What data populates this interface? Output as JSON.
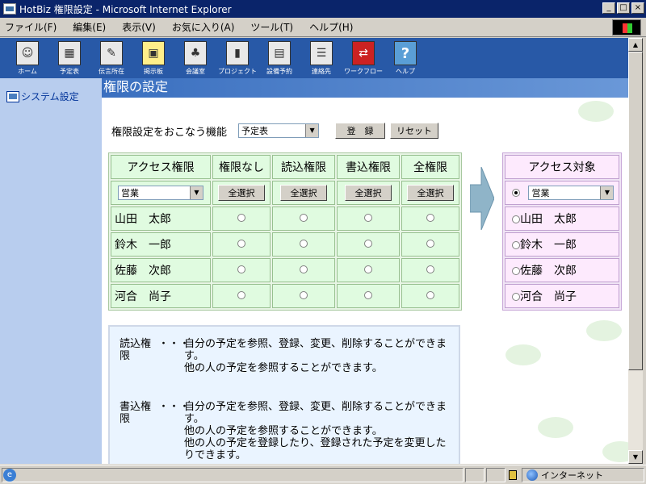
{
  "window": {
    "title": "HotBiz 権限設定 - Microsoft Internet Explorer",
    "controls": [
      "_",
      "□",
      "×"
    ]
  },
  "menu": [
    "ファイル(F)",
    "編集(E)",
    "表示(V)",
    "お気に入り(A)",
    "ツール(T)",
    "ヘルプ(H)"
  ],
  "toolbar": [
    {
      "label": "ホーム",
      "icon": "person-icon"
    },
    {
      "label": "予定表",
      "icon": "calendar-icon"
    },
    {
      "label": "伝言所在",
      "icon": "message-icon"
    },
    {
      "label": "掲示板",
      "icon": "board-icon"
    },
    {
      "label": "会議室",
      "icon": "meeting-icon"
    },
    {
      "label": "プロジェクト",
      "icon": "chart-icon"
    },
    {
      "label": "設備予約",
      "icon": "equipment-icon"
    },
    {
      "label": "連絡先",
      "icon": "contacts-icon"
    },
    {
      "label": "ワークフロー",
      "icon": "workflow-icon"
    },
    {
      "label": "ヘルプ",
      "icon": "help-icon"
    }
  ],
  "sidebar": {
    "item": "システム設定"
  },
  "main": {
    "title": "権限の設定",
    "function_label": "権限設定をおこなう機能",
    "function_value": "予定表",
    "register_btn": "登　録",
    "reset_btn": "リセット"
  },
  "perm_table": {
    "headers": [
      "アクセス権限",
      "権限なし",
      "読込権限",
      "書込権限",
      "全権限"
    ],
    "group_value": "営業",
    "select_all": "全選択",
    "users": [
      "山田　太郎",
      "鈴木　一郎",
      "佐藤　次郎",
      "河合　尚子"
    ]
  },
  "target_table": {
    "header": "アクセス対象",
    "group_value": "営業",
    "users": [
      "山田　太郎",
      "鈴木　一郎",
      "佐藤　次郎",
      "河合　尚子"
    ]
  },
  "descriptions": [
    {
      "term": "読込権限",
      "dots": "・・・",
      "lines": [
        "自分の予定を参照、登録、変更、削除することができます。",
        "他の人の予定を参照することができます。"
      ]
    },
    {
      "term": "書込権限",
      "dots": "・・・",
      "lines": [
        "自分の予定を参照、登録、変更、削除することができます。",
        "他の人の予定を参照することができます。",
        "他の人の予定を登録したり、登録された予定を変更したりできます。"
      ]
    }
  ],
  "status": {
    "zone": "インターネット"
  },
  "colors": {
    "titlebar": "#0a246a",
    "toolbar": "#2859a7",
    "sidebar": "#b8cdee",
    "page_title": "#4a7ec8"
  }
}
